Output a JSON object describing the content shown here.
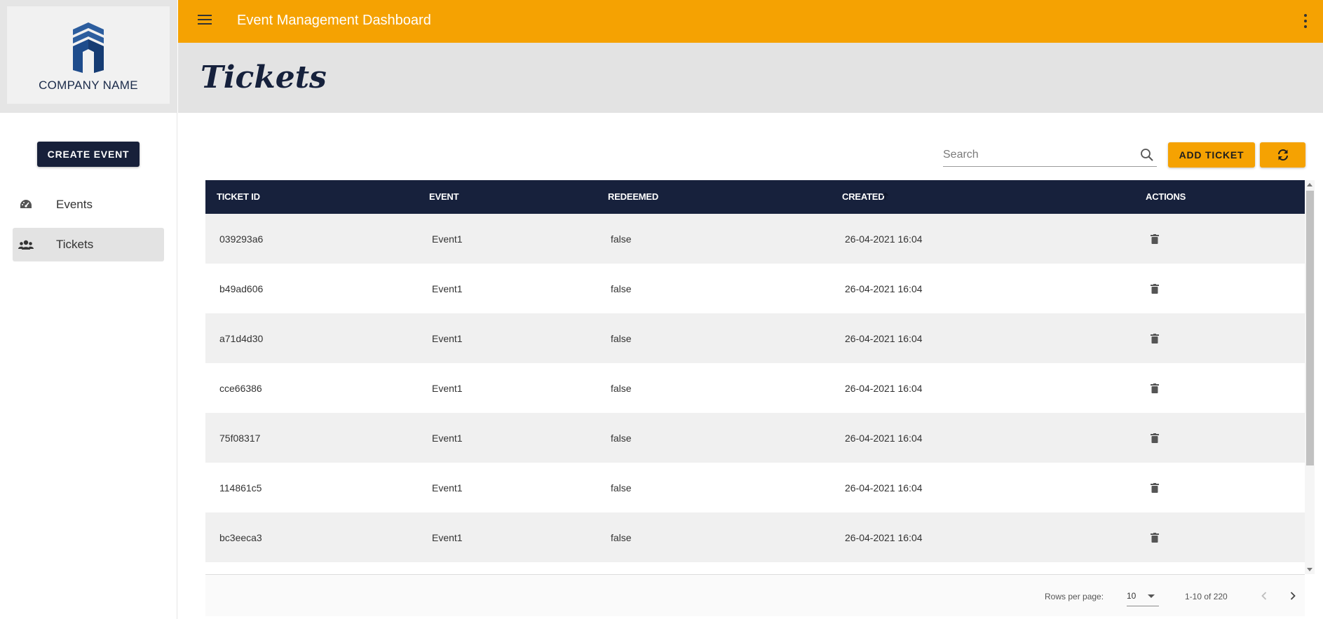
{
  "sidebar": {
    "company_name": "COMPANY NAME",
    "create_button": "CREATE EVENT",
    "items": [
      {
        "label": "Events",
        "icon": "dashboard-gauge-icon",
        "active": false
      },
      {
        "label": "Tickets",
        "icon": "people-group-icon",
        "active": true
      }
    ]
  },
  "appbar": {
    "title": "Event Management Dashboard",
    "color": "#f5a202"
  },
  "page": {
    "title": "Tickets"
  },
  "toolbar": {
    "search_placeholder": "Search",
    "search_value": "",
    "add_button": "ADD TICKET"
  },
  "table": {
    "columns": [
      "TICKET ID",
      "EVENT",
      "REDEEMED",
      "CREATED",
      "ACTIONS"
    ],
    "sorted_column": "CREATED",
    "sort_direction": "asc",
    "rows": [
      {
        "id": "039293a6",
        "event": "Event1",
        "redeemed": "false",
        "created": "26-04-2021 16:04"
      },
      {
        "id": "b49ad606",
        "event": "Event1",
        "redeemed": "false",
        "created": "26-04-2021 16:04"
      },
      {
        "id": "a71d4d30",
        "event": "Event1",
        "redeemed": "false",
        "created": "26-04-2021 16:04"
      },
      {
        "id": "cce66386",
        "event": "Event1",
        "redeemed": "false",
        "created": "26-04-2021 16:04"
      },
      {
        "id": "75f08317",
        "event": "Event1",
        "redeemed": "false",
        "created": "26-04-2021 16:04"
      },
      {
        "id": "114861c5",
        "event": "Event1",
        "redeemed": "false",
        "created": "26-04-2021 16:04"
      },
      {
        "id": "bc3eeca3",
        "event": "Event1",
        "redeemed": "false",
        "created": "26-04-2021 16:04"
      }
    ]
  },
  "pagination": {
    "rows_per_page_label": "Rows per page:",
    "rows_per_page": "10",
    "range": "1-10 of 220"
  },
  "colors": {
    "accent": "#f5a202",
    "navy": "#17213c",
    "header_band": "#e3e3e3"
  }
}
